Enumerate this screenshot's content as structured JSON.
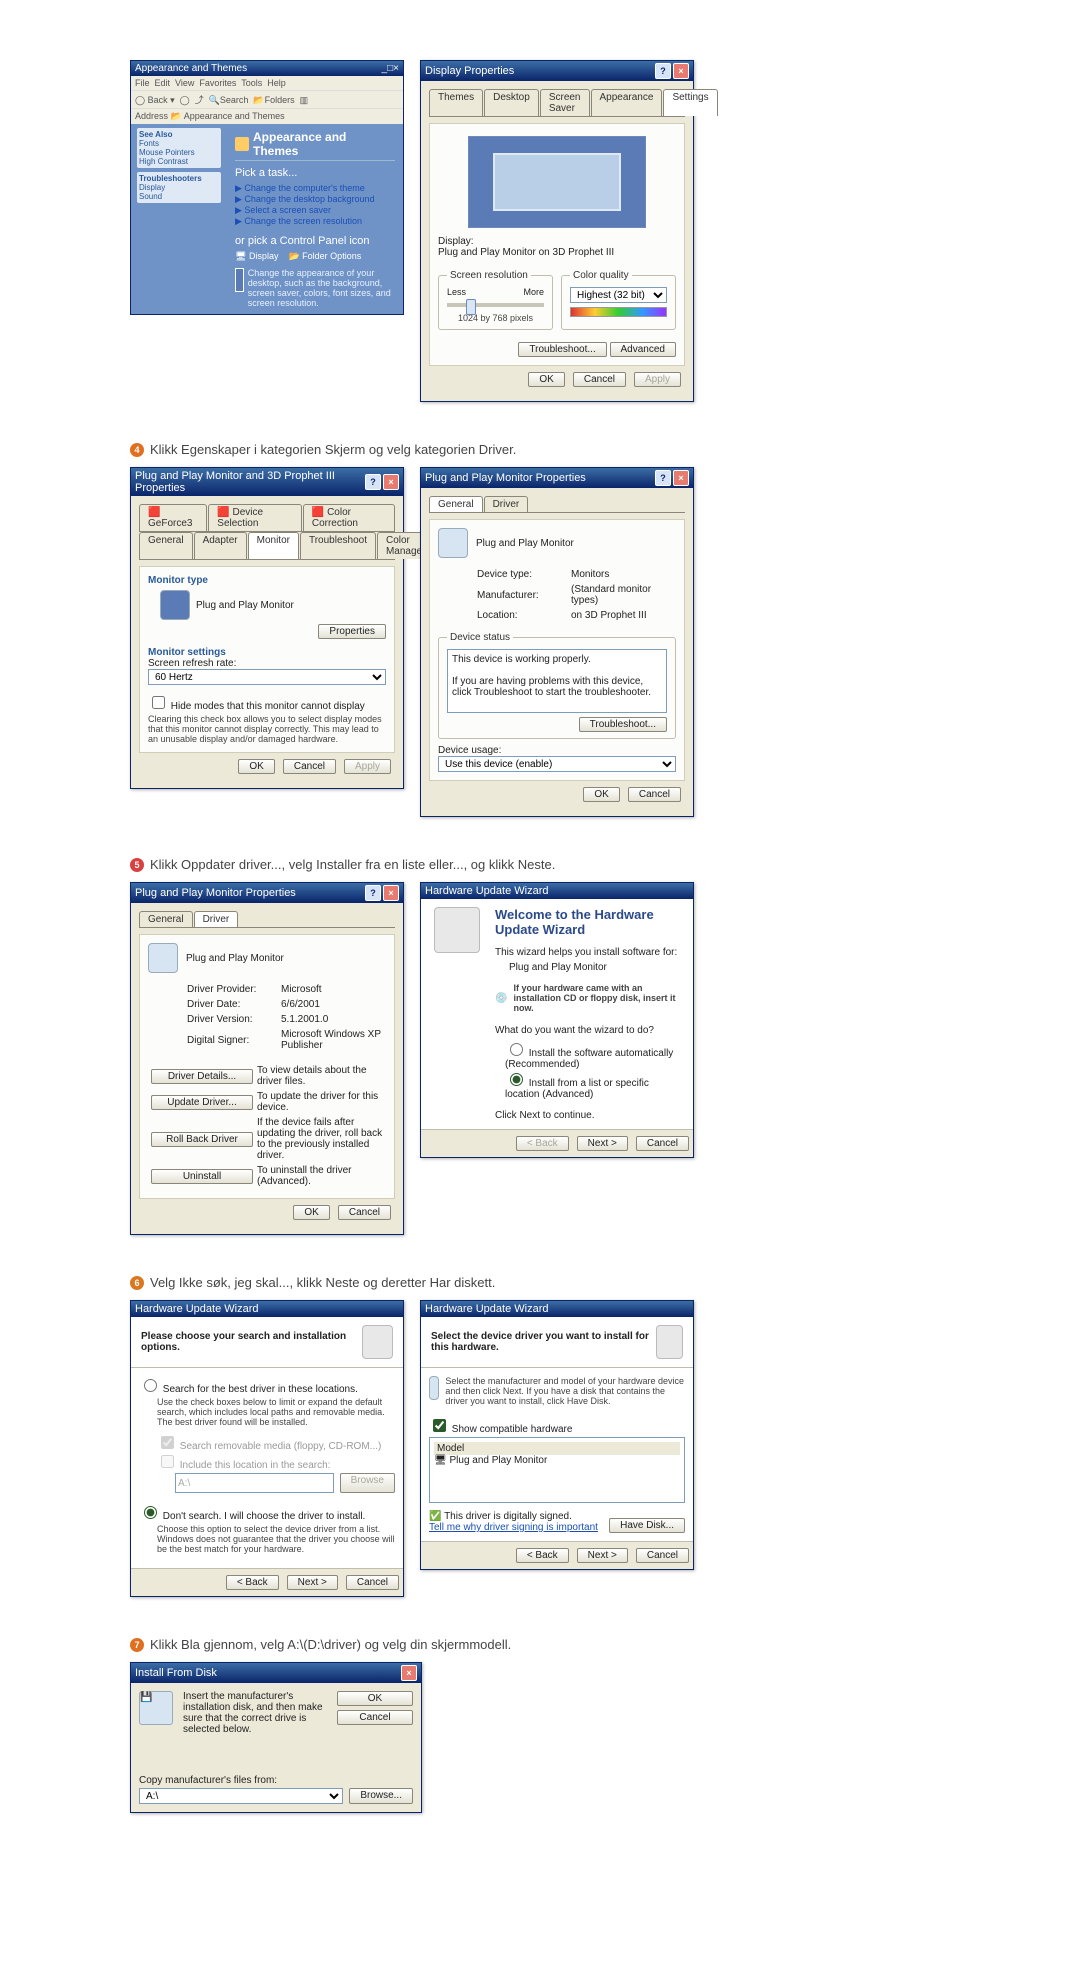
{
  "steps": {
    "s4": "Klikk Egenskaper i kategorien Skjerm og velg kategorien Driver.",
    "s5": "Klikk Oppdater driver..., velg Installer fra en liste eller..., og klikk Neste.",
    "s6": "Velg Ikke søk, jeg skal..., klikk Neste og deretter Har diskett.",
    "s7": "Klikk Bla gjennom, velg A:\\(D:\\driver) og velg din skjermmodell."
  },
  "appearance": {
    "title": "Appearance and Themes",
    "pick": "Pick a task...",
    "t1": "Change the computer's theme",
    "t2": "Change the desktop background",
    "t3": "Select a screen saver",
    "t4": "Change the screen resolution",
    "or": "or pick a Control Panel icon",
    "i1": "Display",
    "i2": "Folder Options",
    "seealso": "See Also",
    "trouble": "Troubleshooters",
    "tip": "Change the appearance of your desktop, such as the background, screen saver, colors, font sizes, and screen resolution."
  },
  "display": {
    "title": "Display Properties",
    "tabs": [
      "Themes",
      "Desktop",
      "Screen Saver",
      "Appearance",
      "Settings"
    ],
    "displayLbl": "Display:",
    "displayVal": "Plug and Play Monitor on 3D Prophet III",
    "resGrp": "Screen resolution",
    "less": "Less",
    "more": "More",
    "resTxt": "1024 by 768 pixels",
    "colGrp": "Color quality",
    "colVal": "Highest (32 bit)",
    "troubleshoot": "Troubleshoot...",
    "advanced": "Advanced",
    "ok": "OK",
    "cancel": "Cancel",
    "apply": "Apply"
  },
  "pnp3d": {
    "title": "Plug and Play Monitor and 3D Prophet III Properties",
    "topTabs": [
      "GeForce3",
      "Device Selection",
      "Color Correction"
    ],
    "tabs": [
      "General",
      "Adapter",
      "Monitor",
      "Troubleshoot",
      "Color Management"
    ],
    "mtype": "Monitor type",
    "mtVal": "Plug and Play Monitor",
    "propBtn": "Properties",
    "mset": "Monitor settings",
    "refresh": "Screen refresh rate:",
    "refVal": "60 Hertz",
    "hideChk": "Hide modes that this monitor cannot display",
    "hideTxt": "Clearing this check box allows you to select display modes that this monitor cannot display correctly. This may lead to an unusable display and/or damaged hardware.",
    "ok": "OK",
    "cancel": "Cancel",
    "apply": "Apply"
  },
  "pnpGen": {
    "title": "Plug and Play Monitor Properties",
    "tabs": [
      "General",
      "Driver"
    ],
    "name": "Plug and Play Monitor",
    "dtLbl": "Device type:",
    "dtVal": "Monitors",
    "mfLbl": "Manufacturer:",
    "mfVal": "(Standard monitor types)",
    "locLbl": "Location:",
    "locVal": "on 3D Prophet III",
    "statusGrp": "Device status",
    "status1": "This device is working properly.",
    "status2": "If you are having problems with this device, click Troubleshoot to start the troubleshooter.",
    "tbtn": "Troubleshoot...",
    "usageLbl": "Device usage:",
    "usageVal": "Use this device (enable)",
    "ok": "OK",
    "cancel": "Cancel"
  },
  "pnpDrv": {
    "title": "Plug and Play Monitor Properties",
    "tabs": [
      "General",
      "Driver"
    ],
    "name": "Plug and Play Monitor",
    "provLbl": "Driver Provider:",
    "provVal": "Microsoft",
    "dateLbl": "Driver Date:",
    "dateVal": "6/6/2001",
    "verLbl": "Driver Version:",
    "verVal": "5.1.2001.0",
    "sigLbl": "Digital Signer:",
    "sigVal": "Microsoft Windows XP Publisher",
    "bDetails": "Driver Details...",
    "bDetailsTxt": "To view details about the driver files.",
    "bUpdate": "Update Driver...",
    "bUpdateTxt": "To update the driver for this device.",
    "bRoll": "Roll Back Driver",
    "bRollTxt": "If the device fails after updating the driver, roll back to the previously installed driver.",
    "bUn": "Uninstall",
    "bUnTxt": "To uninstall the driver (Advanced).",
    "ok": "OK",
    "cancel": "Cancel"
  },
  "wiz1": {
    "title": "Hardware Update Wizard",
    "welcome": "Welcome to the Hardware Update Wizard",
    "intro": "This wizard helps you install software for:",
    "dev": "Plug and Play Monitor",
    "cdTxt": "If your hardware came with an installation CD or floppy disk, insert it now.",
    "q": "What do you want the wizard to do?",
    "r1": "Install the software automatically (Recommended)",
    "r2": "Install from a list or specific location (Advanced)",
    "clickNext": "Click Next to continue.",
    "back": "< Back",
    "next": "Next >",
    "cancel": "Cancel"
  },
  "wiz2": {
    "title": "Hardware Update Wizard",
    "head": "Please choose your search and installation options.",
    "r1": "Search for the best driver in these locations.",
    "r1txt": "Use the check boxes below to limit or expand the default search, which includes local paths and removable media. The best driver found will be installed.",
    "c1": "Search removable media (floppy, CD-ROM...)",
    "c2": "Include this location in the search:",
    "path": "A:\\",
    "browse": "Browse",
    "r2": "Don't search. I will choose the driver to install.",
    "r2txt": "Choose this option to select the device driver from a list. Windows does not guarantee that the driver you choose will be the best match for your hardware.",
    "back": "< Back",
    "next": "Next >",
    "cancel": "Cancel"
  },
  "wiz3": {
    "title": "Hardware Update Wizard",
    "head": "Select the device driver you want to install for this hardware.",
    "txt": "Select the manufacturer and model of your hardware device and then click Next. If you have a disk that contains the driver you want to install, click Have Disk.",
    "show": "Show compatible hardware",
    "model": "Model",
    "item": "Plug and Play Monitor",
    "signed": "This driver is digitally signed.",
    "tell": "Tell me why driver signing is important",
    "have": "Have Disk...",
    "back": "< Back",
    "next": "Next >",
    "cancel": "Cancel"
  },
  "ifd": {
    "title": "Install From Disk",
    "txt": "Insert the manufacturer's installation disk, and then make sure that the correct drive is selected below.",
    "ok": "OK",
    "cancel": "Cancel",
    "copy": "Copy manufacturer's files from:",
    "path": "A:\\",
    "browse": "Browse..."
  }
}
